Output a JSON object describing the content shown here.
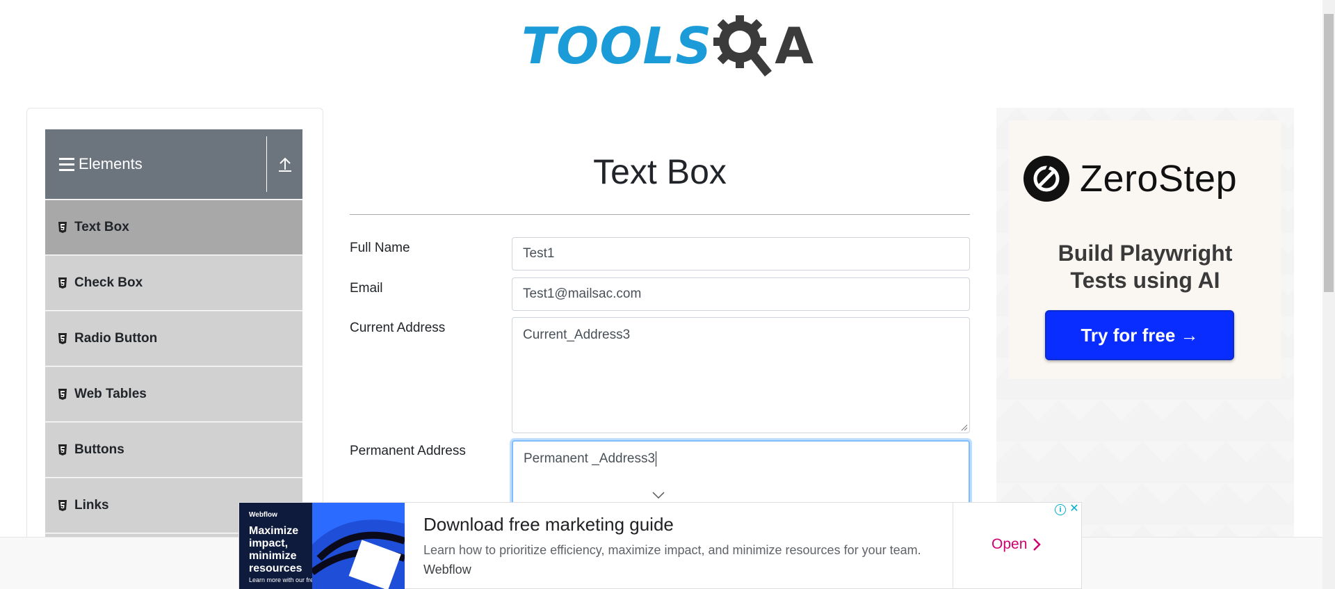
{
  "header": {
    "logo_left": "TOOLS",
    "logo_right": "A"
  },
  "sidebar": {
    "header_title": "Elements",
    "items": [
      {
        "label": "Text Box",
        "active": true
      },
      {
        "label": "Check Box",
        "active": false
      },
      {
        "label": "Radio Button",
        "active": false
      },
      {
        "label": "Web Tables",
        "active": false
      },
      {
        "label": "Buttons",
        "active": false
      },
      {
        "label": "Links",
        "active": false
      }
    ]
  },
  "main": {
    "title": "Text Box",
    "fields": {
      "full_name": {
        "label": "Full Name",
        "value": "Test1"
      },
      "email": {
        "label": "Email",
        "value": "Test1@mailsac.com"
      },
      "current_address": {
        "label": "Current Address",
        "value": "Current_Address3"
      },
      "permanent_address": {
        "label": "Permanent Address",
        "value": "Permanent _Address3"
      }
    }
  },
  "right_ad": {
    "brand": "ZeroStep",
    "tagline_line1": "Build Playwright",
    "tagline_line2": "Tests using AI",
    "cta": "Try for free →"
  },
  "bottom_ad": {
    "image_brand": "Webflow",
    "image_headline": "Maximize impact, minimize resources",
    "image_footer": "Learn more with our free ebook ↗",
    "title": "Download free marketing guide",
    "description": "Learn how to prioritize efficiency, maximize impact, and minimize resources for your team.",
    "source": "Webflow",
    "open_label": "Open"
  },
  "colors": {
    "logo_blue": "#1b9bd7",
    "sidebar_header": "#6c757d",
    "menu_item": "#d1d1d1",
    "menu_item_active": "#a8a8a8",
    "cta_blue": "#0a2dff",
    "open_magenta": "#d0006f"
  }
}
